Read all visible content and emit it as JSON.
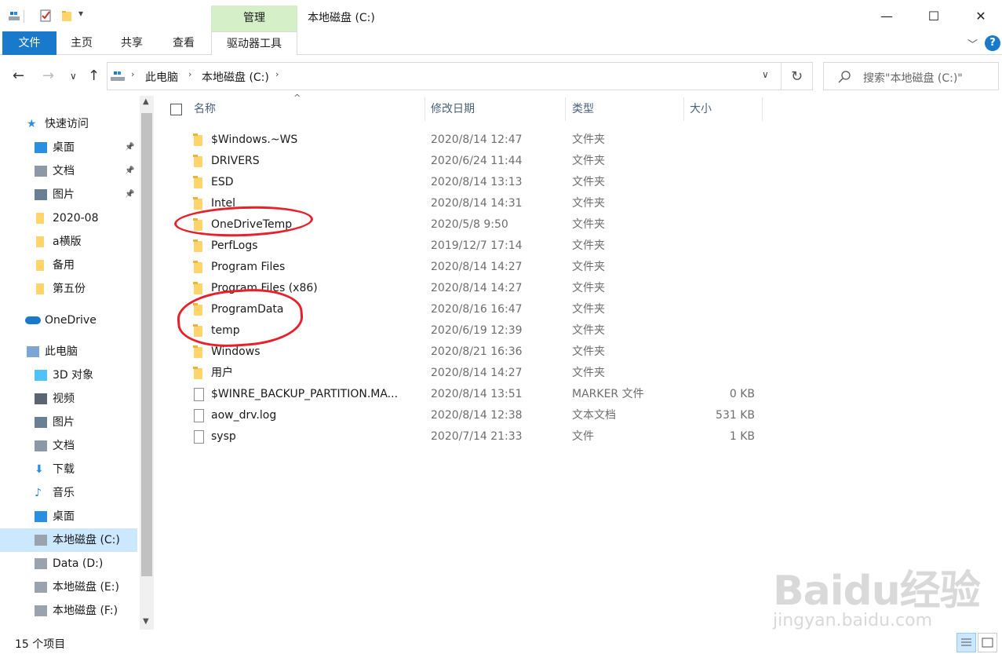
{
  "window": {
    "title": "本地磁盘 (C:)",
    "manage_tab": "管理",
    "controls": [
      "—",
      "☐",
      "✕"
    ]
  },
  "ribbon": {
    "tabs": [
      "文件",
      "主页",
      "共享",
      "查看",
      "驱动器工具"
    ],
    "help": "?"
  },
  "address": {
    "segments": [
      "此电脑",
      "本地磁盘 (C:)"
    ],
    "search_placeholder": "搜索\"本地磁盘 (C:)\""
  },
  "sidebar": {
    "items": [
      {
        "label": "快速访问",
        "icon": "star-icon",
        "level": 0,
        "pinned": false
      },
      {
        "label": "桌面",
        "icon": "desktop-icon",
        "level": 1,
        "pinned": true
      },
      {
        "label": "文档",
        "icon": "document-icon",
        "level": 1,
        "pinned": true
      },
      {
        "label": "图片",
        "icon": "pictures-icon",
        "level": 1,
        "pinned": true
      },
      {
        "label": "2020-08",
        "icon": "folder-icon",
        "level": 1,
        "pinned": false
      },
      {
        "label": "a横版",
        "icon": "folder-icon",
        "level": 1,
        "pinned": false
      },
      {
        "label": "备用",
        "icon": "folder-icon",
        "level": 1,
        "pinned": false
      },
      {
        "label": "第五份",
        "icon": "folder-icon",
        "level": 1,
        "pinned": false
      },
      {
        "label": "OneDrive",
        "icon": "cloud-icon",
        "level": 0,
        "pinned": false
      },
      {
        "label": "此电脑",
        "icon": "computer-icon",
        "level": 0,
        "pinned": false
      },
      {
        "label": "3D 对象",
        "icon": "cube-icon",
        "level": 1,
        "pinned": false
      },
      {
        "label": "视频",
        "icon": "video-icon",
        "level": 1,
        "pinned": false
      },
      {
        "label": "图片",
        "icon": "pictures-icon",
        "level": 1,
        "pinned": false
      },
      {
        "label": "文档",
        "icon": "document-icon",
        "level": 1,
        "pinned": false
      },
      {
        "label": "下载",
        "icon": "download-icon",
        "level": 1,
        "pinned": false
      },
      {
        "label": "音乐",
        "icon": "music-icon",
        "level": 1,
        "pinned": false
      },
      {
        "label": "桌面",
        "icon": "desktop-icon",
        "level": 1,
        "pinned": false
      },
      {
        "label": "本地磁盘 (C:)",
        "icon": "windows-drive-icon",
        "level": 1,
        "pinned": false,
        "selected": true
      },
      {
        "label": "Data (D:)",
        "icon": "drive-icon",
        "level": 1,
        "pinned": false
      },
      {
        "label": "本地磁盘 (E:)",
        "icon": "drive-icon",
        "level": 1,
        "pinned": false
      },
      {
        "label": "本地磁盘 (F:)",
        "icon": "drive-icon",
        "level": 1,
        "pinned": false
      }
    ]
  },
  "columns": {
    "name": "名称",
    "date": "修改日期",
    "type": "类型",
    "size": "大小"
  },
  "files": [
    {
      "name": "$Windows.~WS",
      "date": "2020/8/14 12:47",
      "type": "文件夹",
      "size": "",
      "kind": "folder"
    },
    {
      "name": "DRIVERS",
      "date": "2020/6/24 11:44",
      "type": "文件夹",
      "size": "",
      "kind": "folder"
    },
    {
      "name": "ESD",
      "date": "2020/8/14 13:13",
      "type": "文件夹",
      "size": "",
      "kind": "folder"
    },
    {
      "name": "Intel",
      "date": "2020/8/14 14:31",
      "type": "文件夹",
      "size": "",
      "kind": "folder"
    },
    {
      "name": "OneDriveTemp",
      "date": "2020/5/8 9:50",
      "type": "文件夹",
      "size": "",
      "kind": "folder"
    },
    {
      "name": "PerfLogs",
      "date": "2019/12/7 17:14",
      "type": "文件夹",
      "size": "",
      "kind": "folder"
    },
    {
      "name": "Program Files",
      "date": "2020/8/14 14:27",
      "type": "文件夹",
      "size": "",
      "kind": "folder"
    },
    {
      "name": "Program Files (x86)",
      "date": "2020/8/14 14:27",
      "type": "文件夹",
      "size": "",
      "kind": "folder"
    },
    {
      "name": "ProgramData",
      "date": "2020/8/16 16:47",
      "type": "文件夹",
      "size": "",
      "kind": "folder"
    },
    {
      "name": "temp",
      "date": "2020/6/19 12:39",
      "type": "文件夹",
      "size": "",
      "kind": "folder"
    },
    {
      "name": "Windows",
      "date": "2020/8/21 16:36",
      "type": "文件夹",
      "size": "",
      "kind": "folder"
    },
    {
      "name": "用户",
      "date": "2020/8/14 14:27",
      "type": "文件夹",
      "size": "",
      "kind": "folder"
    },
    {
      "name": "$WINRE_BACKUP_PARTITION.MA...",
      "date": "2020/8/14 13:51",
      "type": "MARKER 文件",
      "size": "0 KB",
      "kind": "file"
    },
    {
      "name": "aow_drv.log",
      "date": "2020/8/14 12:38",
      "type": "文本文档",
      "size": "531 KB",
      "kind": "file"
    },
    {
      "name": "sysp",
      "date": "2020/7/14 21:33",
      "type": "文件",
      "size": "1 KB",
      "kind": "file"
    }
  ],
  "status": {
    "count": "15 个项目"
  },
  "watermark": {
    "brand": "Baidu经验",
    "url": "jingyan.baidu.com"
  },
  "colors": {
    "accent": "#1979ca",
    "manage_tab": "#d5f0c9",
    "selection": "#cce8ff",
    "annotation": "#e8202a",
    "folder": "#ffd46b"
  }
}
